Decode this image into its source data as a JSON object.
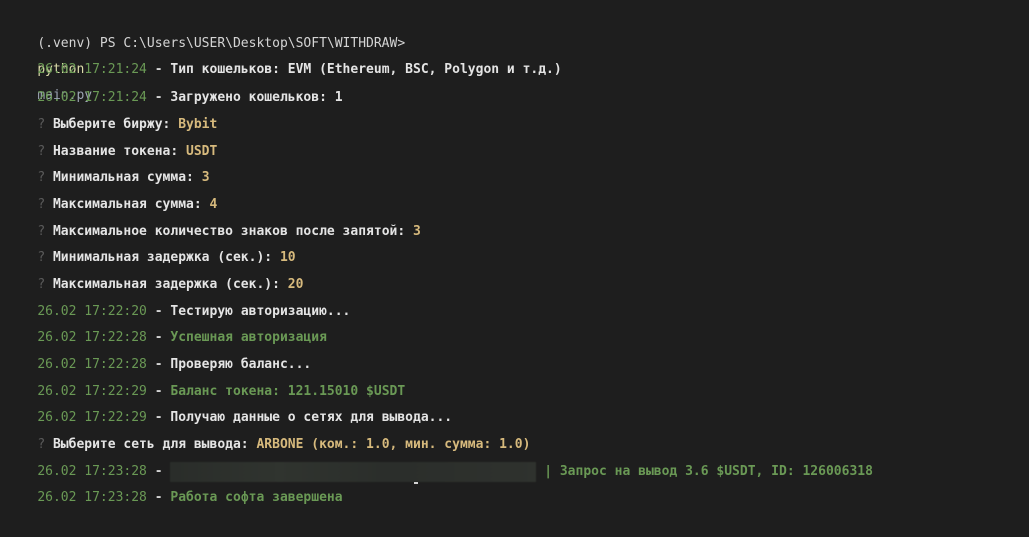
{
  "prompt": {
    "text": "(.venv) PS C:\\Users\\USER\\Desktop\\SOFT\\WITHDRAW>",
    "command": "python",
    "argument": "main.py"
  },
  "lines": [
    {
      "time": "26.02 17:21:24",
      "sep": " - ",
      "label": "Тип кошельков: EVM (Ethereum, BSC, Polygon и т.д.)"
    },
    {
      "time": "26.02 17:21:24",
      "sep": " - ",
      "label": "Загружено кошельков: 1"
    },
    {
      "q": "?",
      "label": "Выберите биржу: ",
      "value": "Bybit"
    },
    {
      "q": "?",
      "label": "Название токена: ",
      "value": "USDT"
    },
    {
      "q": "?",
      "label": "Минимальная сумма: ",
      "value": "3"
    },
    {
      "q": "?",
      "label": "Максимальная сумма: ",
      "value": "4"
    },
    {
      "q": "?",
      "label": "Максимальное количество знаков после запятой: ",
      "value": "3"
    },
    {
      "q": "?",
      "label": "Минимальная задержка (сек.): ",
      "value": "10"
    },
    {
      "q": "?",
      "label": "Максимальная задержка (сек.): ",
      "value": "20"
    },
    {
      "time": "26.02 17:22:20",
      "sep": " - ",
      "label": "Тестирую авторизацию..."
    },
    {
      "time": "26.02 17:22:28",
      "sep": " - ",
      "label": "Успешная авторизация"
    },
    {
      "time": "26.02 17:22:28",
      "sep": " - ",
      "label": "Проверяю баланс..."
    },
    {
      "time": "26.02 17:22:29",
      "sep": " - ",
      "label": "Баланс токена: 121.15010 $USDT"
    },
    {
      "time": "26.02 17:22:29",
      "sep": " - ",
      "label": "Получаю данные о сетях для вывода..."
    },
    {
      "q": "?",
      "label": "Выберите сеть для вывода: ",
      "value": "ARBONE (ком.: 1.0, мин. сумма: 1.0)"
    },
    {
      "time": "26.02 17:23:28",
      "sep": " - ",
      "label": " | Запрос на вывод 3.6 $USDT, ID: 126006318"
    },
    {
      "time": "26.02 17:23:28",
      "sep": " - ",
      "label": "Работа софта завершена"
    }
  ],
  "colors": {
    "background": "#1e1e1e",
    "timestamp": "#6a9955",
    "success": "#6a9955",
    "value": "#d7ba7d",
    "text": "#e4e4e4"
  }
}
